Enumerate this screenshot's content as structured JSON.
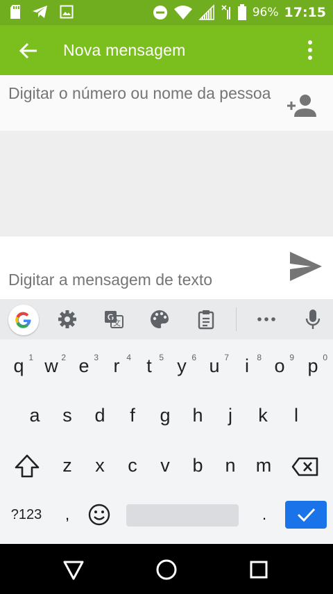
{
  "status_bar": {
    "battery_percent": "96%",
    "time": "17:15",
    "left_icons": [
      "sd-card-icon",
      "telegram-icon",
      "image-icon"
    ],
    "right_icons": [
      "do-not-disturb-icon",
      "wifi-icon",
      "signal-icon",
      "no-signal-icon",
      "battery-icon"
    ]
  },
  "app_bar": {
    "title": "Nova mensagem",
    "color": "#7bbf1e",
    "status_color": "#70ad1f"
  },
  "recipient": {
    "placeholder": "Digitar o número ou nome da pessoa"
  },
  "compose": {
    "placeholder": "Digitar a mensagem de texto"
  },
  "keyboard": {
    "toolbar_icons": [
      "google-icon",
      "settings-icon",
      "translate-icon",
      "palette-icon",
      "clipboard-icon",
      "more-icon",
      "mic-icon"
    ],
    "row1": [
      {
        "key": "q",
        "hint": "1"
      },
      {
        "key": "w",
        "hint": "2"
      },
      {
        "key": "e",
        "hint": "3"
      },
      {
        "key": "r",
        "hint": "4"
      },
      {
        "key": "t",
        "hint": "5"
      },
      {
        "key": "y",
        "hint": "6"
      },
      {
        "key": "u",
        "hint": "7"
      },
      {
        "key": "i",
        "hint": "8"
      },
      {
        "key": "o",
        "hint": "9"
      },
      {
        "key": "p",
        "hint": "0"
      }
    ],
    "row2": [
      "a",
      "s",
      "d",
      "f",
      "g",
      "h",
      "j",
      "k",
      "l"
    ],
    "row3": [
      "z",
      "x",
      "c",
      "v",
      "b",
      "n",
      "m"
    ],
    "symbols_label": "?123",
    "comma": ",",
    "period": ".",
    "accent_color": "#1a73e8"
  }
}
